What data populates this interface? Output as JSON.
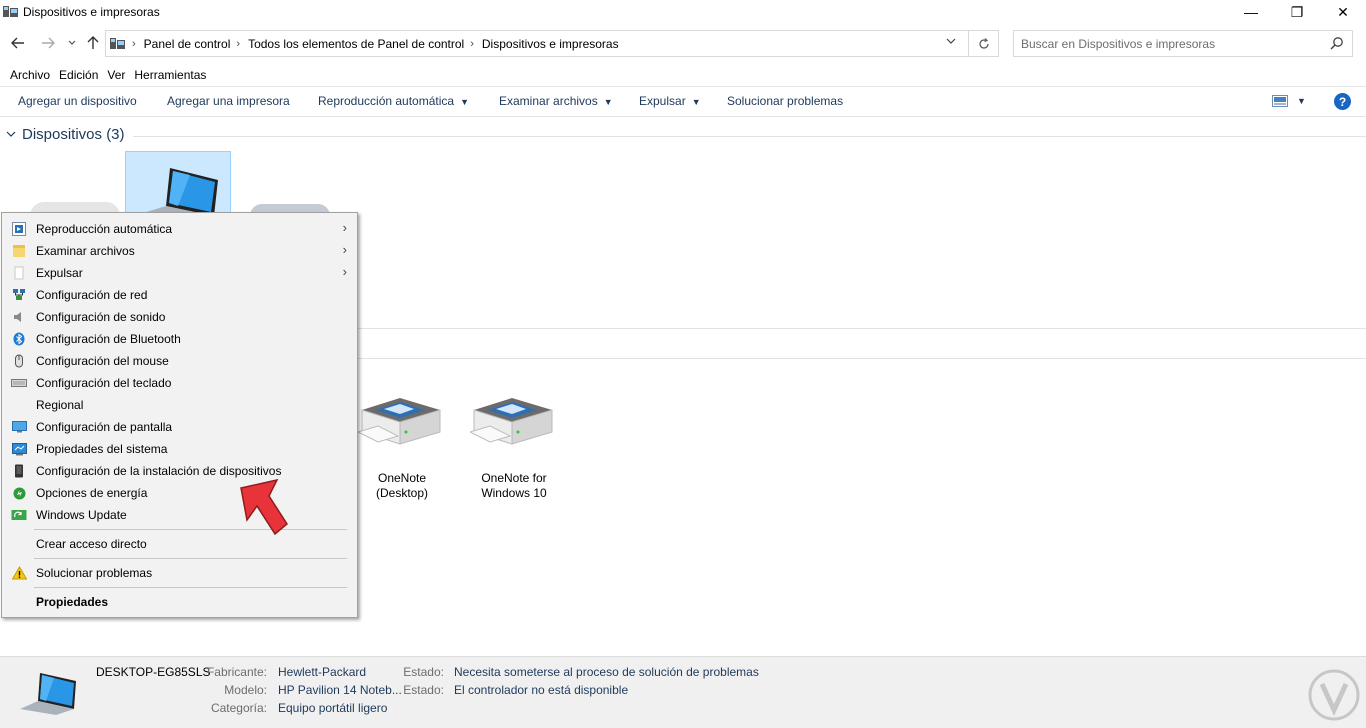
{
  "window": {
    "title": "Dispositivos e impresoras",
    "minimize": "—",
    "maximize": "❐",
    "close": "✕"
  },
  "address": {
    "breadcrumbs": [
      "Panel de control",
      "Todos los elementos de Panel de control",
      "Dispositivos e impresoras"
    ],
    "search_placeholder": "Buscar en Dispositivos e impresoras"
  },
  "menubar": [
    "Archivo",
    "Edición",
    "Ver",
    "Herramientas"
  ],
  "toolbar": {
    "add_device": "Agregar un dispositivo",
    "add_printer": "Agregar una impresora",
    "autoplay": "Reproducción automática",
    "browse_files": "Examinar archivos",
    "eject": "Expulsar",
    "troubleshoot": "Solucionar problemas",
    "help": "?"
  },
  "group": {
    "title": "Dispositivos (3)"
  },
  "printers": [
    {
      "name_line1": "OneNote",
      "name_line2": "(Desktop)"
    },
    {
      "name_line1": "OneNote for",
      "name_line2": "Windows 10"
    }
  ],
  "context_menu": {
    "items": [
      {
        "label": "Reproducción automática",
        "icon": "autoplay-icon",
        "submenu": true
      },
      {
        "label": "Examinar archivos",
        "icon": "folder-icon",
        "submenu": true
      },
      {
        "label": "Expulsar",
        "icon": "eject-icon",
        "submenu": true
      },
      {
        "label": "Configuración de red",
        "icon": "network-icon"
      },
      {
        "label": "Configuración de sonido",
        "icon": "speaker-icon"
      },
      {
        "label": "Configuración de Bluetooth",
        "icon": "bluetooth-icon"
      },
      {
        "label": "Configuración del mouse",
        "icon": "mouse-icon"
      },
      {
        "label": "Configuración del teclado",
        "icon": "keyboard-icon"
      },
      {
        "label": "Regional",
        "icon": ""
      },
      {
        "label": "Configuración de pantalla",
        "icon": "display-icon"
      },
      {
        "label": "Propiedades del sistema",
        "icon": "system-icon"
      },
      {
        "label": "Configuración de la instalación de dispositivos",
        "icon": "device-install-icon"
      },
      {
        "label": "Opciones de energía",
        "icon": "power-icon"
      },
      {
        "label": "Windows Update",
        "icon": "windows-update-icon"
      },
      {
        "label": "Crear acceso directo",
        "icon": ""
      },
      {
        "label": "Solucionar problemas",
        "icon": "warning-icon"
      },
      {
        "label": "Propiedades",
        "icon": ""
      }
    ]
  },
  "details": {
    "device_name": "DESKTOP-EG85SLS",
    "manufacturer_label": "Fabricante:",
    "manufacturer": "Hewlett-Packard",
    "model_label": "Modelo:",
    "model": "HP Pavilion 14 Noteb...",
    "category_label": "Categoría:",
    "category": "Equipo portátil ligero",
    "status1_label": "Estado:",
    "status1": "Necesita someterse al proceso de solución de problemas",
    "status2_label": "Estado:",
    "status2": "El controlador no está disponible"
  },
  "colors": {
    "accent": "#1e395b",
    "selection": "#cce8ff",
    "help": "#1766c3",
    "arrow": "#e8333a"
  }
}
